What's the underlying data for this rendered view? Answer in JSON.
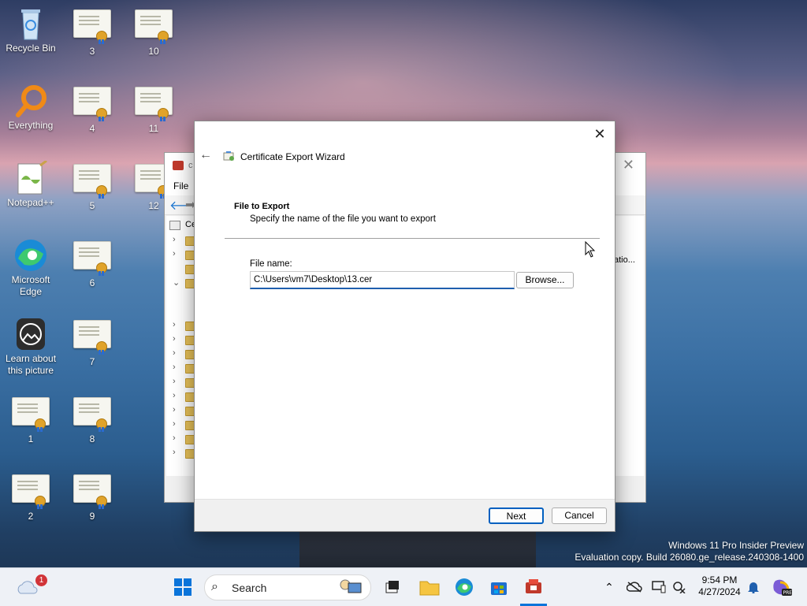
{
  "desktop": {
    "icons": [
      {
        "label": "Recycle Bin"
      },
      {
        "label": "Everything"
      },
      {
        "label": "Notepad++"
      },
      {
        "label": "Microsoft Edge"
      },
      {
        "label": "Learn about this picture"
      },
      {
        "label": "1"
      },
      {
        "label": "2"
      },
      {
        "label": "3"
      },
      {
        "label": "4"
      },
      {
        "label": "5"
      },
      {
        "label": "6"
      },
      {
        "label": "7"
      },
      {
        "label": "8"
      },
      {
        "label": "9"
      },
      {
        "label": "10"
      },
      {
        "label": "11"
      },
      {
        "label": "12"
      }
    ]
  },
  "mmc": {
    "menu_file": "File",
    "tree_root": "Ce",
    "pane_text": "atio...",
    "title_fragment": "c"
  },
  "wizard": {
    "title": "Certificate Export Wizard",
    "heading": "File to Export",
    "subheading": "Specify the name of the file you want to export",
    "file_label": "File name:",
    "file_value": "C:\\Users\\vm7\\Desktop\\13.cer",
    "browse_label": "Browse...",
    "next_label": "Next",
    "cancel_label": "Cancel"
  },
  "watermark": {
    "line1": "Windows 11 Pro Insider Preview",
    "line2": "Evaluation copy. Build 26080.ge_release.240308-1400"
  },
  "taskbar": {
    "search_placeholder": "Search",
    "weather_badge": "1",
    "time": "9:54 PM",
    "date": "4/27/2024"
  },
  "colors": {
    "accent": "#0060c0",
    "taskbar_bg": "#eef1f6"
  }
}
